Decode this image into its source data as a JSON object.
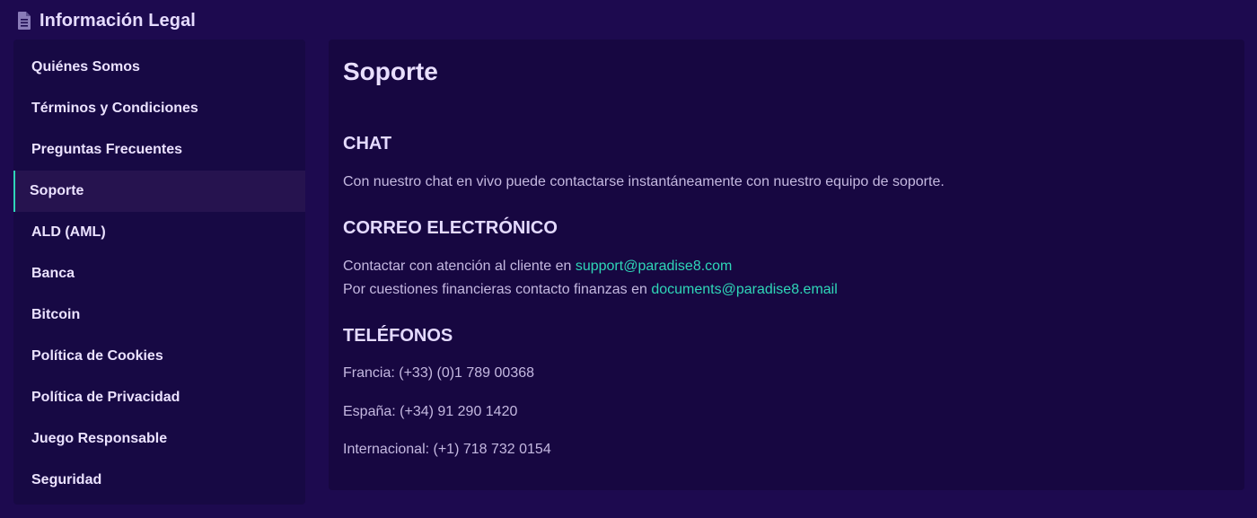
{
  "header": {
    "icon": "document-icon",
    "title": "Información Legal"
  },
  "sidebar": {
    "items": [
      {
        "label": "Quiénes Somos",
        "active": false
      },
      {
        "label": "Términos y Condiciones",
        "active": false
      },
      {
        "label": "Preguntas Frecuentes",
        "active": false
      },
      {
        "label": "Soporte",
        "active": true
      },
      {
        "label": "ALD (AML)",
        "active": false
      },
      {
        "label": "Banca",
        "active": false
      },
      {
        "label": "Bitcoin",
        "active": false
      },
      {
        "label": "Política de Cookies",
        "active": false
      },
      {
        "label": "Política de Privacidad",
        "active": false
      },
      {
        "label": "Juego Responsable",
        "active": false
      },
      {
        "label": "Seguridad",
        "active": false
      }
    ]
  },
  "main": {
    "title": "Soporte",
    "chat": {
      "heading": "CHAT",
      "text": "Con nuestro chat en vivo puede contactarse instantáneamente con nuestro equipo de soporte."
    },
    "email": {
      "heading": "CORREO ELECTRÓNICO",
      "line1_prefix": "Contactar con atención al cliente en ",
      "line1_link": "support@paradise8.com",
      "line2_prefix": "Por cuestiones financieras contacto finanzas en ",
      "line2_link": "documents@paradise8.email"
    },
    "phones": {
      "heading": "TELÉFONOS",
      "lines": [
        "Francia: (+33) (0)1 789 00368",
        "España: (+34) 91 290 1420",
        "Internacional: (+1) 718 732 0154"
      ]
    }
  },
  "colors": {
    "background": "#1d0a4f",
    "panel": "#170741",
    "accent": "#2fd6b8",
    "active_item": "#26134f"
  }
}
